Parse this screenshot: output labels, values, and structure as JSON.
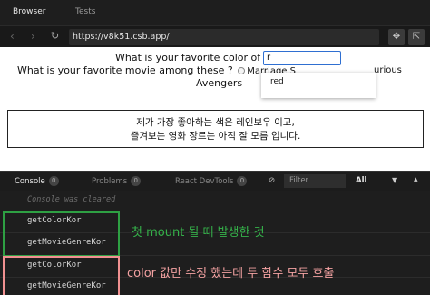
{
  "top_tabs": {
    "browser": "Browser",
    "tests": "Tests"
  },
  "nav": {
    "back_icon": "chevron-left-icon",
    "forward_icon": "chevron-right-icon",
    "refresh_icon": "refresh-icon",
    "url": "https://v8k51.csb.app/"
  },
  "preview": {
    "q1_text": "What is your favorite color of rainbow ?",
    "color_input_value": "r",
    "q2_text": "What is your favorite movie among these ?",
    "options": [
      "Marriage S",
      "Avengers",
      "urious"
    ],
    "dropdown_suggestion": "red",
    "result_line1": "제가 가장 좋아하는 색은 레인보우 이고,",
    "result_line2": "즐겨보는 영화 장르는 아직 잘 모름 입니다."
  },
  "console": {
    "tabs": [
      {
        "label": "Console",
        "count": "0"
      },
      {
        "label": "Problems",
        "count": "0"
      },
      {
        "label": "React DevTools",
        "count": "0"
      }
    ],
    "filter_placeholder": "Filter",
    "level": "All",
    "cleared": "Console was cleared",
    "logs": [
      "getColorKor",
      "getMovieGenreKor",
      "getColorKor",
      "getMovieGenreKor"
    ]
  },
  "annotations": {
    "first": "첫 mount 될 때 발생한 것",
    "second": "color 값만 수정 했는데 두 함수 모두 호출"
  },
  "colors": {
    "green_box": "#2ea043",
    "pink_box": "#f19191",
    "input_focus": "#2f6fd1"
  }
}
